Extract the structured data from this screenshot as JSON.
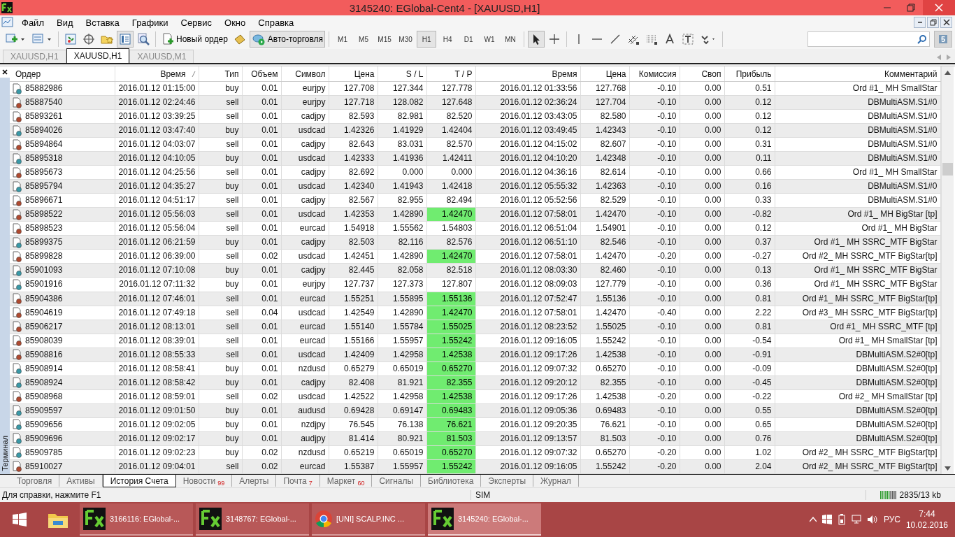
{
  "window": {
    "title": "3145240: EGlobal-Cent4 - [XAUUSD,H1]"
  },
  "menu": [
    "Файл",
    "Вид",
    "Вставка",
    "Графики",
    "Сервис",
    "Окно",
    "Справка"
  ],
  "toolbar": {
    "panel_buttons": [
      {
        "on": false
      },
      {
        "on": false
      },
      {
        "on": false
      },
      {
        "on": true
      },
      {
        "on": false
      }
    ],
    "order_button": {
      "label": "Новый ордер"
    },
    "auto_trading": {
      "label": "Авто-торговля",
      "on": true
    },
    "timeframes": [
      {
        "label": "M1",
        "selected": false
      },
      {
        "label": "M5",
        "selected": false
      },
      {
        "label": "M15",
        "selected": false
      },
      {
        "label": "M30",
        "selected": false
      },
      {
        "label": "H1",
        "selected": true
      },
      {
        "label": "H4",
        "selected": false
      },
      {
        "label": "D1",
        "selected": false
      },
      {
        "label": "W1",
        "selected": false
      },
      {
        "label": "MN",
        "selected": false
      }
    ],
    "cursor_tools": [
      {
        "on": true
      },
      {
        "on": false
      }
    ],
    "message_badge": "5"
  },
  "chart_tabs": [
    {
      "label": "XAUUSD,H1",
      "selected": false
    },
    {
      "label": "XAUUSD,H1",
      "selected": true
    },
    {
      "label": "XAUUSD,M1",
      "selected": false
    }
  ],
  "terminal": {
    "title": "Терминал"
  },
  "table": {
    "columns": [
      {
        "label": "Ордер",
        "sorted": false
      },
      {
        "label": "Время",
        "sorted": true
      },
      {
        "label": "Тип",
        "sorted": false
      },
      {
        "label": "Объем",
        "sorted": false
      },
      {
        "label": "Символ",
        "sorted": false
      },
      {
        "label": "Цена",
        "sorted": false
      },
      {
        "label": "S / L",
        "sorted": false
      },
      {
        "label": "T / P",
        "sorted": false
      },
      {
        "label": "Время",
        "sorted": false
      },
      {
        "label": "Цена",
        "sorted": false
      },
      {
        "label": "Комиссия",
        "sorted": false
      },
      {
        "label": "Своп",
        "sorted": false
      },
      {
        "label": "Прибыль",
        "sorted": false
      },
      {
        "label": "Комментарий",
        "sorted": false
      }
    ],
    "rows": [
      {
        "kind": "buy",
        "order": "85882986",
        "open_time": "2016.01.12 01:15:00",
        "type": "buy",
        "volume": "0.01",
        "symbol": "eurjpy",
        "open_price": "127.708",
        "sl": "127.344",
        "tp": "127.778",
        "tp_hit": false,
        "close_time": "2016.01.12 01:33:56",
        "close_price": "127.768",
        "commission": "-0.10",
        "swap": "0.00",
        "profit": "0.51",
        "comment": "Ord #1_ MH SmallStar"
      },
      {
        "kind": "sell",
        "order": "85887540",
        "open_time": "2016.01.12 02:24:46",
        "type": "sell",
        "volume": "0.01",
        "symbol": "eurjpy",
        "open_price": "127.718",
        "sl": "128.082",
        "tp": "127.648",
        "tp_hit": false,
        "close_time": "2016.01.12 02:36:24",
        "close_price": "127.704",
        "commission": "-0.10",
        "swap": "0.00",
        "profit": "0.12",
        "comment": "DBMultiASM.S1#0"
      },
      {
        "kind": "sell",
        "order": "85893261",
        "open_time": "2016.01.12 03:39:25",
        "type": "sell",
        "volume": "0.01",
        "symbol": "cadjpy",
        "open_price": "82.593",
        "sl": "82.981",
        "tp": "82.520",
        "tp_hit": false,
        "close_time": "2016.01.12 03:43:05",
        "close_price": "82.580",
        "commission": "-0.10",
        "swap": "0.00",
        "profit": "0.12",
        "comment": "DBMultiASM.S1#0"
      },
      {
        "kind": "buy",
        "order": "85894026",
        "open_time": "2016.01.12 03:47:40",
        "type": "buy",
        "volume": "0.01",
        "symbol": "usdcad",
        "open_price": "1.42326",
        "sl": "1.41929",
        "tp": "1.42404",
        "tp_hit": false,
        "close_time": "2016.01.12 03:49:45",
        "close_price": "1.42343",
        "commission": "-0.10",
        "swap": "0.00",
        "profit": "0.12",
        "comment": "DBMultiASM.S1#0"
      },
      {
        "kind": "sell",
        "order": "85894864",
        "open_time": "2016.01.12 04:03:07",
        "type": "sell",
        "volume": "0.01",
        "symbol": "cadjpy",
        "open_price": "82.643",
        "sl": "83.031",
        "tp": "82.570",
        "tp_hit": false,
        "close_time": "2016.01.12 04:15:02",
        "close_price": "82.607",
        "commission": "-0.10",
        "swap": "0.00",
        "profit": "0.31",
        "comment": "DBMultiASM.S1#0"
      },
      {
        "kind": "buy",
        "order": "85895318",
        "open_time": "2016.01.12 04:10:05",
        "type": "buy",
        "volume": "0.01",
        "symbol": "usdcad",
        "open_price": "1.42333",
        "sl": "1.41936",
        "tp": "1.42411",
        "tp_hit": false,
        "close_time": "2016.01.12 04:10:20",
        "close_price": "1.42348",
        "commission": "-0.10",
        "swap": "0.00",
        "profit": "0.11",
        "comment": "DBMultiASM.S1#0"
      },
      {
        "kind": "sell",
        "order": "85895673",
        "open_time": "2016.01.12 04:25:56",
        "type": "sell",
        "volume": "0.01",
        "symbol": "cadjpy",
        "open_price": "82.692",
        "sl": "0.000",
        "tp": "0.000",
        "tp_hit": false,
        "close_time": "2016.01.12 04:36:16",
        "close_price": "82.614",
        "commission": "-0.10",
        "swap": "0.00",
        "profit": "0.66",
        "comment": "Ord #1_ MH SmallStar"
      },
      {
        "kind": "buy",
        "order": "85895794",
        "open_time": "2016.01.12 04:35:27",
        "type": "buy",
        "volume": "0.01",
        "symbol": "usdcad",
        "open_price": "1.42340",
        "sl": "1.41943",
        "tp": "1.42418",
        "tp_hit": false,
        "close_time": "2016.01.12 05:55:32",
        "close_price": "1.42363",
        "commission": "-0.10",
        "swap": "0.00",
        "profit": "0.16",
        "comment": "DBMultiASM.S1#0"
      },
      {
        "kind": "sell",
        "order": "85896671",
        "open_time": "2016.01.12 04:51:17",
        "type": "sell",
        "volume": "0.01",
        "symbol": "cadjpy",
        "open_price": "82.567",
        "sl": "82.955",
        "tp": "82.494",
        "tp_hit": false,
        "close_time": "2016.01.12 05:52:56",
        "close_price": "82.529",
        "commission": "-0.10",
        "swap": "0.00",
        "profit": "0.33",
        "comment": "DBMultiASM.S1#0"
      },
      {
        "kind": "sell",
        "order": "85898522",
        "open_time": "2016.01.12 05:56:03",
        "type": "sell",
        "volume": "0.01",
        "symbol": "usdcad",
        "open_price": "1.42353",
        "sl": "1.42890",
        "tp": "1.42470",
        "tp_hit": true,
        "close_time": "2016.01.12 07:58:01",
        "close_price": "1.42470",
        "commission": "-0.10",
        "swap": "0.00",
        "profit": "-0.82",
        "comment": "Ord #1_ MH BigStar [tp]"
      },
      {
        "kind": "sell",
        "order": "85898523",
        "open_time": "2016.01.12 05:56:04",
        "type": "sell",
        "volume": "0.01",
        "symbol": "eurcad",
        "open_price": "1.54918",
        "sl": "1.55562",
        "tp": "1.54803",
        "tp_hit": false,
        "close_time": "2016.01.12 06:51:04",
        "close_price": "1.54901",
        "commission": "-0.10",
        "swap": "0.00",
        "profit": "0.12",
        "comment": "Ord #1_ MH BigStar"
      },
      {
        "kind": "buy",
        "order": "85899375",
        "open_time": "2016.01.12 06:21:59",
        "type": "buy",
        "volume": "0.01",
        "symbol": "cadjpy",
        "open_price": "82.503",
        "sl": "82.116",
        "tp": "82.576",
        "tp_hit": false,
        "close_time": "2016.01.12 06:51:10",
        "close_price": "82.546",
        "commission": "-0.10",
        "swap": "0.00",
        "profit": "0.37",
        "comment": "Ord #1_ MH SSRC_MTF BigStar"
      },
      {
        "kind": "sell",
        "order": "85899828",
        "open_time": "2016.01.12 06:39:00",
        "type": "sell",
        "volume": "0.02",
        "symbol": "usdcad",
        "open_price": "1.42451",
        "sl": "1.42890",
        "tp": "1.42470",
        "tp_hit": true,
        "close_time": "2016.01.12 07:58:01",
        "close_price": "1.42470",
        "commission": "-0.20",
        "swap": "0.00",
        "profit": "-0.27",
        "comment": "Ord #2_ MH SSRC_MTF BigStar[tp]"
      },
      {
        "kind": "buy",
        "order": "85901093",
        "open_time": "2016.01.12 07:10:08",
        "type": "buy",
        "volume": "0.01",
        "symbol": "cadjpy",
        "open_price": "82.445",
        "sl": "82.058",
        "tp": "82.518",
        "tp_hit": false,
        "close_time": "2016.01.12 08:03:30",
        "close_price": "82.460",
        "commission": "-0.10",
        "swap": "0.00",
        "profit": "0.13",
        "comment": "Ord #1_ MH SSRC_MTF BigStar"
      },
      {
        "kind": "buy",
        "order": "85901916",
        "open_time": "2016.01.12 07:11:32",
        "type": "buy",
        "volume": "0.01",
        "symbol": "eurjpy",
        "open_price": "127.737",
        "sl": "127.373",
        "tp": "127.807",
        "tp_hit": false,
        "close_time": "2016.01.12 08:09:03",
        "close_price": "127.779",
        "commission": "-0.10",
        "swap": "0.00",
        "profit": "0.36",
        "comment": "Ord #1_ MH SSRC_MTF BigStar"
      },
      {
        "kind": "sell",
        "order": "85904386",
        "open_time": "2016.01.12 07:46:01",
        "type": "sell",
        "volume": "0.01",
        "symbol": "eurcad",
        "open_price": "1.55251",
        "sl": "1.55895",
        "tp": "1.55136",
        "tp_hit": true,
        "close_time": "2016.01.12 07:52:47",
        "close_price": "1.55136",
        "commission": "-0.10",
        "swap": "0.00",
        "profit": "0.81",
        "comment": "Ord #1_ MH SSRC_MTF BigStar[tp]"
      },
      {
        "kind": "sell",
        "order": "85904619",
        "open_time": "2016.01.12 07:49:18",
        "type": "sell",
        "volume": "0.04",
        "symbol": "usdcad",
        "open_price": "1.42549",
        "sl": "1.42890",
        "tp": "1.42470",
        "tp_hit": true,
        "close_time": "2016.01.12 07:58:01",
        "close_price": "1.42470",
        "commission": "-0.40",
        "swap": "0.00",
        "profit": "2.22",
        "comment": "Ord #3_ MH SSRC_MTF BigStar[tp]"
      },
      {
        "kind": "sell",
        "order": "85906217",
        "open_time": "2016.01.12 08:13:01",
        "type": "sell",
        "volume": "0.01",
        "symbol": "eurcad",
        "open_price": "1.55140",
        "sl": "1.55784",
        "tp": "1.55025",
        "tp_hit": true,
        "close_time": "2016.01.12 08:23:52",
        "close_price": "1.55025",
        "commission": "-0.10",
        "swap": "0.00",
        "profit": "0.81",
        "comment": "Ord #1_ MH SSRC_MTF [tp]"
      },
      {
        "kind": "sell",
        "order": "85908039",
        "open_time": "2016.01.12 08:39:01",
        "type": "sell",
        "volume": "0.01",
        "symbol": "eurcad",
        "open_price": "1.55166",
        "sl": "1.55957",
        "tp": "1.55242",
        "tp_hit": true,
        "close_time": "2016.01.12 09:16:05",
        "close_price": "1.55242",
        "commission": "-0.10",
        "swap": "0.00",
        "profit": "-0.54",
        "comment": "Ord #1_ MH SmallStar [tp]"
      },
      {
        "kind": "sell",
        "order": "85908816",
        "open_time": "2016.01.12 08:55:33",
        "type": "sell",
        "volume": "0.01",
        "symbol": "usdcad",
        "open_price": "1.42409",
        "sl": "1.42958",
        "tp": "1.42538",
        "tp_hit": true,
        "close_time": "2016.01.12 09:17:26",
        "close_price": "1.42538",
        "commission": "-0.10",
        "swap": "0.00",
        "profit": "-0.91",
        "comment": "DBMultiASM.S2#0[tp]"
      },
      {
        "kind": "buy",
        "order": "85908914",
        "open_time": "2016.01.12 08:58:41",
        "type": "buy",
        "volume": "0.01",
        "symbol": "nzdusd",
        "open_price": "0.65279",
        "sl": "0.65019",
        "tp": "0.65270",
        "tp_hit": true,
        "close_time": "2016.01.12 09:07:32",
        "close_price": "0.65270",
        "commission": "-0.10",
        "swap": "0.00",
        "profit": "-0.09",
        "comment": "DBMultiASM.S2#0[tp]"
      },
      {
        "kind": "buy",
        "order": "85908924",
        "open_time": "2016.01.12 08:58:42",
        "type": "buy",
        "volume": "0.01",
        "symbol": "cadjpy",
        "open_price": "82.408",
        "sl": "81.921",
        "tp": "82.355",
        "tp_hit": true,
        "close_time": "2016.01.12 09:20:12",
        "close_price": "82.355",
        "commission": "-0.10",
        "swap": "0.00",
        "profit": "-0.45",
        "comment": "DBMultiASM.S2#0[tp]"
      },
      {
        "kind": "sell",
        "order": "85908968",
        "open_time": "2016.01.12 08:59:01",
        "type": "sell",
        "volume": "0.02",
        "symbol": "usdcad",
        "open_price": "1.42522",
        "sl": "1.42958",
        "tp": "1.42538",
        "tp_hit": true,
        "close_time": "2016.01.12 09:17:26",
        "close_price": "1.42538",
        "commission": "-0.20",
        "swap": "0.00",
        "profit": "-0.22",
        "comment": "Ord #2_ MH SmallStar [tp]"
      },
      {
        "kind": "buy",
        "order": "85909597",
        "open_time": "2016.01.12 09:01:50",
        "type": "buy",
        "volume": "0.01",
        "symbol": "audusd",
        "open_price": "0.69428",
        "sl": "0.69147",
        "tp": "0.69483",
        "tp_hit": true,
        "close_time": "2016.01.12 09:05:36",
        "close_price": "0.69483",
        "commission": "-0.10",
        "swap": "0.00",
        "profit": "0.55",
        "comment": "DBMultiASM.S2#0[tp]"
      },
      {
        "kind": "buy",
        "order": "85909656",
        "open_time": "2016.01.12 09:02:05",
        "type": "buy",
        "volume": "0.01",
        "symbol": "nzdjpy",
        "open_price": "76.545",
        "sl": "76.138",
        "tp": "76.621",
        "tp_hit": true,
        "close_time": "2016.01.12 09:20:35",
        "close_price": "76.621",
        "commission": "-0.10",
        "swap": "0.00",
        "profit": "0.65",
        "comment": "DBMultiASM.S2#0[tp]"
      },
      {
        "kind": "buy",
        "order": "85909696",
        "open_time": "2016.01.12 09:02:17",
        "type": "buy",
        "volume": "0.01",
        "symbol": "audjpy",
        "open_price": "81.414",
        "sl": "80.921",
        "tp": "81.503",
        "tp_hit": true,
        "close_time": "2016.01.12 09:13:57",
        "close_price": "81.503",
        "commission": "-0.10",
        "swap": "0.00",
        "profit": "0.76",
        "comment": "DBMultiASM.S2#0[tp]"
      },
      {
        "kind": "buy",
        "order": "85909785",
        "open_time": "2016.01.12 09:02:23",
        "type": "buy",
        "volume": "0.02",
        "symbol": "nzdusd",
        "open_price": "0.65219",
        "sl": "0.65019",
        "tp": "0.65270",
        "tp_hit": true,
        "close_time": "2016.01.12 09:07:32",
        "close_price": "0.65270",
        "commission": "-0.20",
        "swap": "0.00",
        "profit": "1.02",
        "comment": "Ord #2_ MH SSRC_MTF BigStar[tp]"
      },
      {
        "kind": "sell",
        "order": "85910027",
        "open_time": "2016.01.12 09:04:01",
        "type": "sell",
        "volume": "0.02",
        "symbol": "eurcad",
        "open_price": "1.55387",
        "sl": "1.55957",
        "tp": "1.55242",
        "tp_hit": true,
        "close_time": "2016.01.12 09:16:05",
        "close_price": "1.55242",
        "commission": "-0.20",
        "swap": "0.00",
        "profit": "2.04",
        "comment": "Ord #2_ MH SSRC_MTF BigStar[tp]"
      }
    ]
  },
  "terminal_tabs": [
    {
      "label": "Торговля",
      "selected": false
    },
    {
      "label": "Активы",
      "selected": false
    },
    {
      "label": "История Счета",
      "selected": true
    },
    {
      "label": "Новости",
      "count": "99",
      "selected": false
    },
    {
      "label": "Алерты",
      "selected": false
    },
    {
      "label": "Почта",
      "count": "7",
      "selected": false
    },
    {
      "label": "Маркет",
      "count": "60",
      "selected": false
    },
    {
      "label": "Сигналы",
      "selected": false
    },
    {
      "label": "Библиотека",
      "selected": false
    },
    {
      "label": "Эксперты",
      "selected": false
    },
    {
      "label": "Журнал",
      "selected": false
    }
  ],
  "status_bar": {
    "help": "Для справки, нажмите F1",
    "profile": "SIM",
    "traffic": "2835/13 kb"
  },
  "taskbar": {
    "apps": [
      {
        "kind": "terminal",
        "label": "3166116: EGlobal-...",
        "selected": false
      },
      {
        "kind": "terminal",
        "label": "3148767: EGlobal-...",
        "selected": false
      },
      {
        "kind": "browser",
        "label": "[UNI] SCALP.INC ...",
        "selected": false
      },
      {
        "kind": "terminal",
        "label": "3145240: EGlobal-...",
        "selected": true
      }
    ],
    "language": "РУС",
    "time": "7:44",
    "date": "10.02.2016"
  }
}
